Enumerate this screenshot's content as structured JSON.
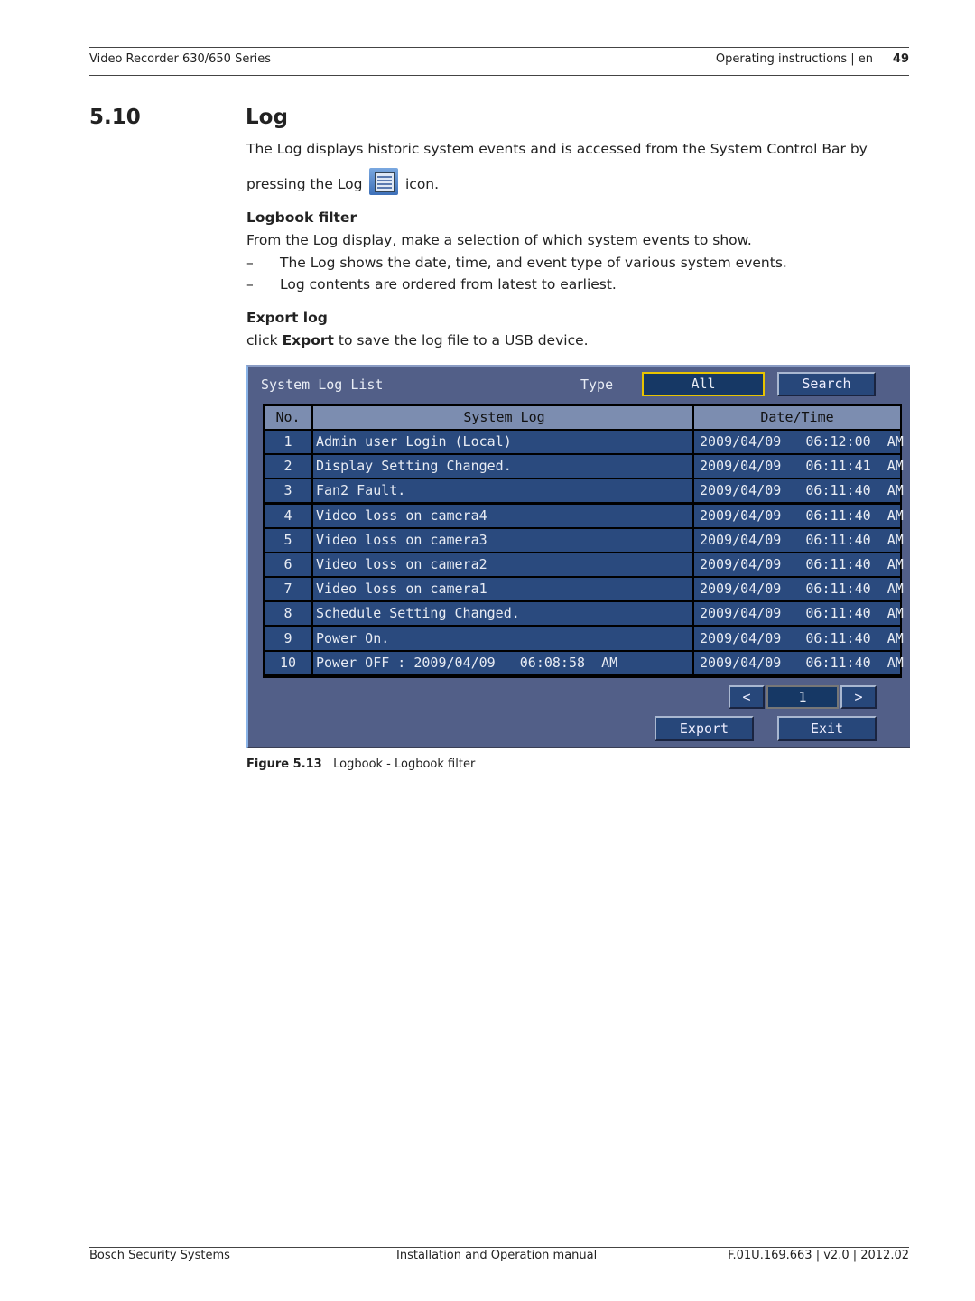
{
  "header": {
    "left": "Video Recorder 630/650 Series",
    "right": "Operating instructions | en",
    "page": "49"
  },
  "section": {
    "number": "5.10",
    "title": "Log"
  },
  "intro_1": "The Log displays historic system events and is accessed from the System Control Bar by",
  "intro_2a": "pressing the Log",
  "intro_2b": "icon.",
  "filter": {
    "heading": "Logbook filter",
    "text": "From the Log display, make a selection of which system events to show.",
    "bullets": [
      "The Log shows the date, time, and event type of various system events.",
      "Log contents are ordered from latest to earliest."
    ],
    "dash": "–"
  },
  "export": {
    "heading": "Export log",
    "pre": "click",
    "bold": "Export",
    "post": "to save the log file to a USB device."
  },
  "ui": {
    "title": "System Log List",
    "type_label": "Type",
    "type_value": "All",
    "search": "Search",
    "columns": [
      "No.",
      "System Log",
      "Date/Time"
    ],
    "rows": [
      [
        "1",
        "Admin user Login (Local)",
        "2009/04/09   06:12:00  AM"
      ],
      [
        "2",
        "Display Setting Changed.",
        "2009/04/09   06:11:41  AM"
      ],
      [
        "3",
        "Fan2 Fault.",
        "2009/04/09   06:11:40  AM"
      ],
      [
        "4",
        "Video loss on camera4",
        "2009/04/09   06:11:40  AM"
      ],
      [
        "5",
        "Video loss on camera3",
        "2009/04/09   06:11:40  AM"
      ],
      [
        "6",
        "Video loss on camera2",
        "2009/04/09   06:11:40  AM"
      ],
      [
        "7",
        "Video loss on camera1",
        "2009/04/09   06:11:40  AM"
      ],
      [
        "8",
        "Schedule Setting Changed.",
        "2009/04/09   06:11:40  AM"
      ],
      [
        "9",
        "Power On.",
        "2009/04/09   06:11:40  AM"
      ],
      [
        "10",
        "Power OFF : 2009/04/09   06:08:58  AM",
        "2009/04/09   06:11:40  AM"
      ]
    ],
    "prev": "<",
    "page": "1",
    "next": ">",
    "export": "Export",
    "exit": "Exit"
  },
  "caption": {
    "label": "Figure  5.13",
    "text": "Logbook - Logbook filter"
  },
  "footer": {
    "left": "Bosch Security Systems",
    "center": "Installation and Operation manual",
    "right": "F.01U.169.663 | v2.0 | 2012.02"
  }
}
